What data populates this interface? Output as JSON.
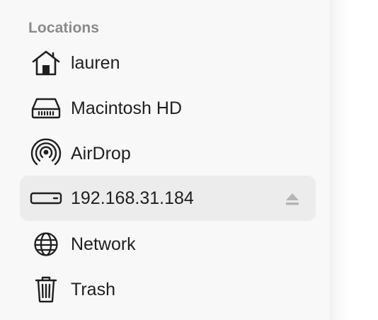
{
  "sidebar": {
    "section_title": "Locations",
    "items": [
      {
        "label": "lauren",
        "icon": "home-icon"
      },
      {
        "label": "Macintosh HD",
        "icon": "internal-drive-icon"
      },
      {
        "label": "AirDrop",
        "icon": "airdrop-icon"
      },
      {
        "label": "192.168.31.184",
        "icon": "network-server-icon",
        "selected": true,
        "eject_icon": "eject-icon"
      },
      {
        "label": "Network",
        "icon": "globe-icon"
      },
      {
        "label": "Trash",
        "icon": "trash-icon"
      }
    ]
  },
  "colors": {
    "sidebar_background": "#f8f8f8",
    "selection_background": "#ececec",
    "section_title": "#8a8a8a",
    "label_text": "#1f1f1f",
    "icon_stroke": "#1f1f1f",
    "eject_icon": "#b5b5b5"
  }
}
